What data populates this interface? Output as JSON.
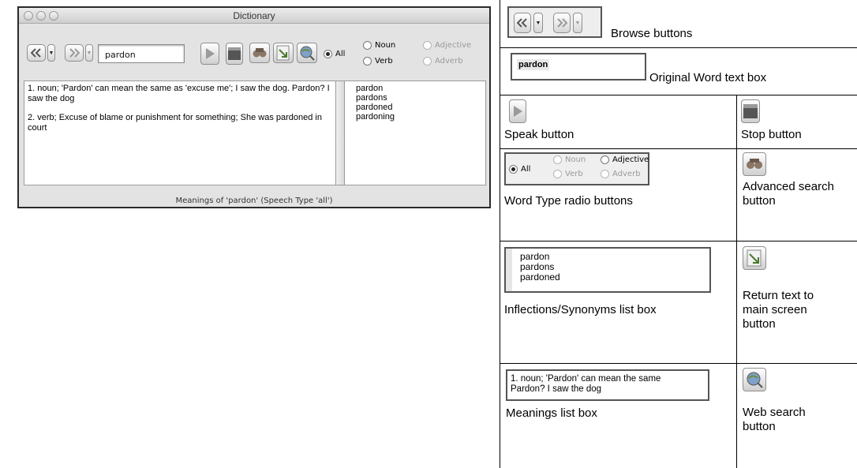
{
  "window": {
    "title": "Dictionary",
    "word_input": "pardon",
    "radios": [
      {
        "label": "All",
        "selected": true,
        "enabled": true
      },
      {
        "label": "Noun",
        "selected": false,
        "enabled": true
      },
      {
        "label": "Verb",
        "selected": false,
        "enabled": true
      },
      {
        "label": "Adjective",
        "selected": false,
        "enabled": false
      },
      {
        "label": "Adverb",
        "selected": false,
        "enabled": false
      }
    ],
    "meanings": [
      "1. noun; 'Pardon' can mean the same as 'excuse me'; I saw the dog. Pardon? I saw the dog",
      "2. verb; Excuse of blame or punishment for something; She was pardoned in court"
    ],
    "inflections": [
      "pardon",
      "pardons",
      "pardoned",
      "pardoning"
    ],
    "status": "Meanings of 'pardon' (Speech Type 'all')"
  },
  "legend": {
    "browse": "Browse buttons",
    "original_word_value": "pardon",
    "original_word": "Original Word text box",
    "speak": "Speak button",
    "stop": "Stop button",
    "word_type": "Word Type radio buttons",
    "word_type_radios": {
      "all": "All",
      "noun": "Noun",
      "adjective": "Adjective",
      "verb": "Verb",
      "adverb": "Adverb"
    },
    "advanced_search": "Advanced search button",
    "inflections_sample": [
      "pardon",
      "pardons",
      "pardoned"
    ],
    "inflections": "Inflections/Synonyms list box",
    "return_text": "Return text to main screen button",
    "meanings_sample": [
      "1. noun; 'Pardon' can mean the same",
      "Pardon? I saw the dog"
    ],
    "meanings": "Meanings list box",
    "web_search": "Web search button"
  },
  "icons": [
    "back-arrow-icon",
    "forward-arrow-icon",
    "dropdown-arrow-icon",
    "play-icon",
    "stop-icon",
    "binoculars-icon",
    "return-text-icon",
    "web-search-icon"
  ]
}
